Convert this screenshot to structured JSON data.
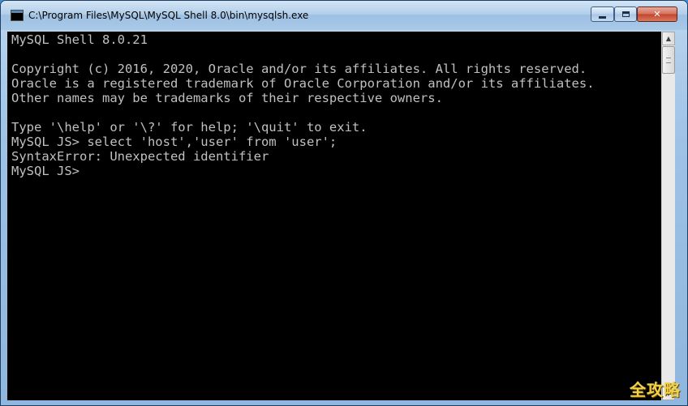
{
  "window": {
    "title": "C:\\Program Files\\MySQL\\MySQL Shell 8.0\\bin\\mysqlsh.exe",
    "icon": "console-app-icon",
    "controls": {
      "minimize_icon": "minimize-icon",
      "maximize_icon": "maximize-icon",
      "close_label": "✕"
    }
  },
  "console": {
    "lines": [
      "MySQL Shell 8.0.21",
      "",
      "Copyright (c) 2016, 2020, Oracle and/or its affiliates. All rights reserved.",
      "Oracle is a registered trademark of Oracle Corporation and/or its affiliates.",
      "Other names may be trademarks of their respective owners.",
      "",
      "Type '\\help' or '\\?' for help; '\\quit' to exit.",
      "MySQL JS> select 'host','user' from 'user';",
      "SyntaxError: Unexpected identifier",
      "MySQL JS> "
    ],
    "text_color": "#c0c0c0",
    "background_color": "#000000"
  },
  "scrollbar": {
    "up_arrow": "▲",
    "down_arrow": "▼"
  },
  "watermark": {
    "text": "全攻略"
  }
}
